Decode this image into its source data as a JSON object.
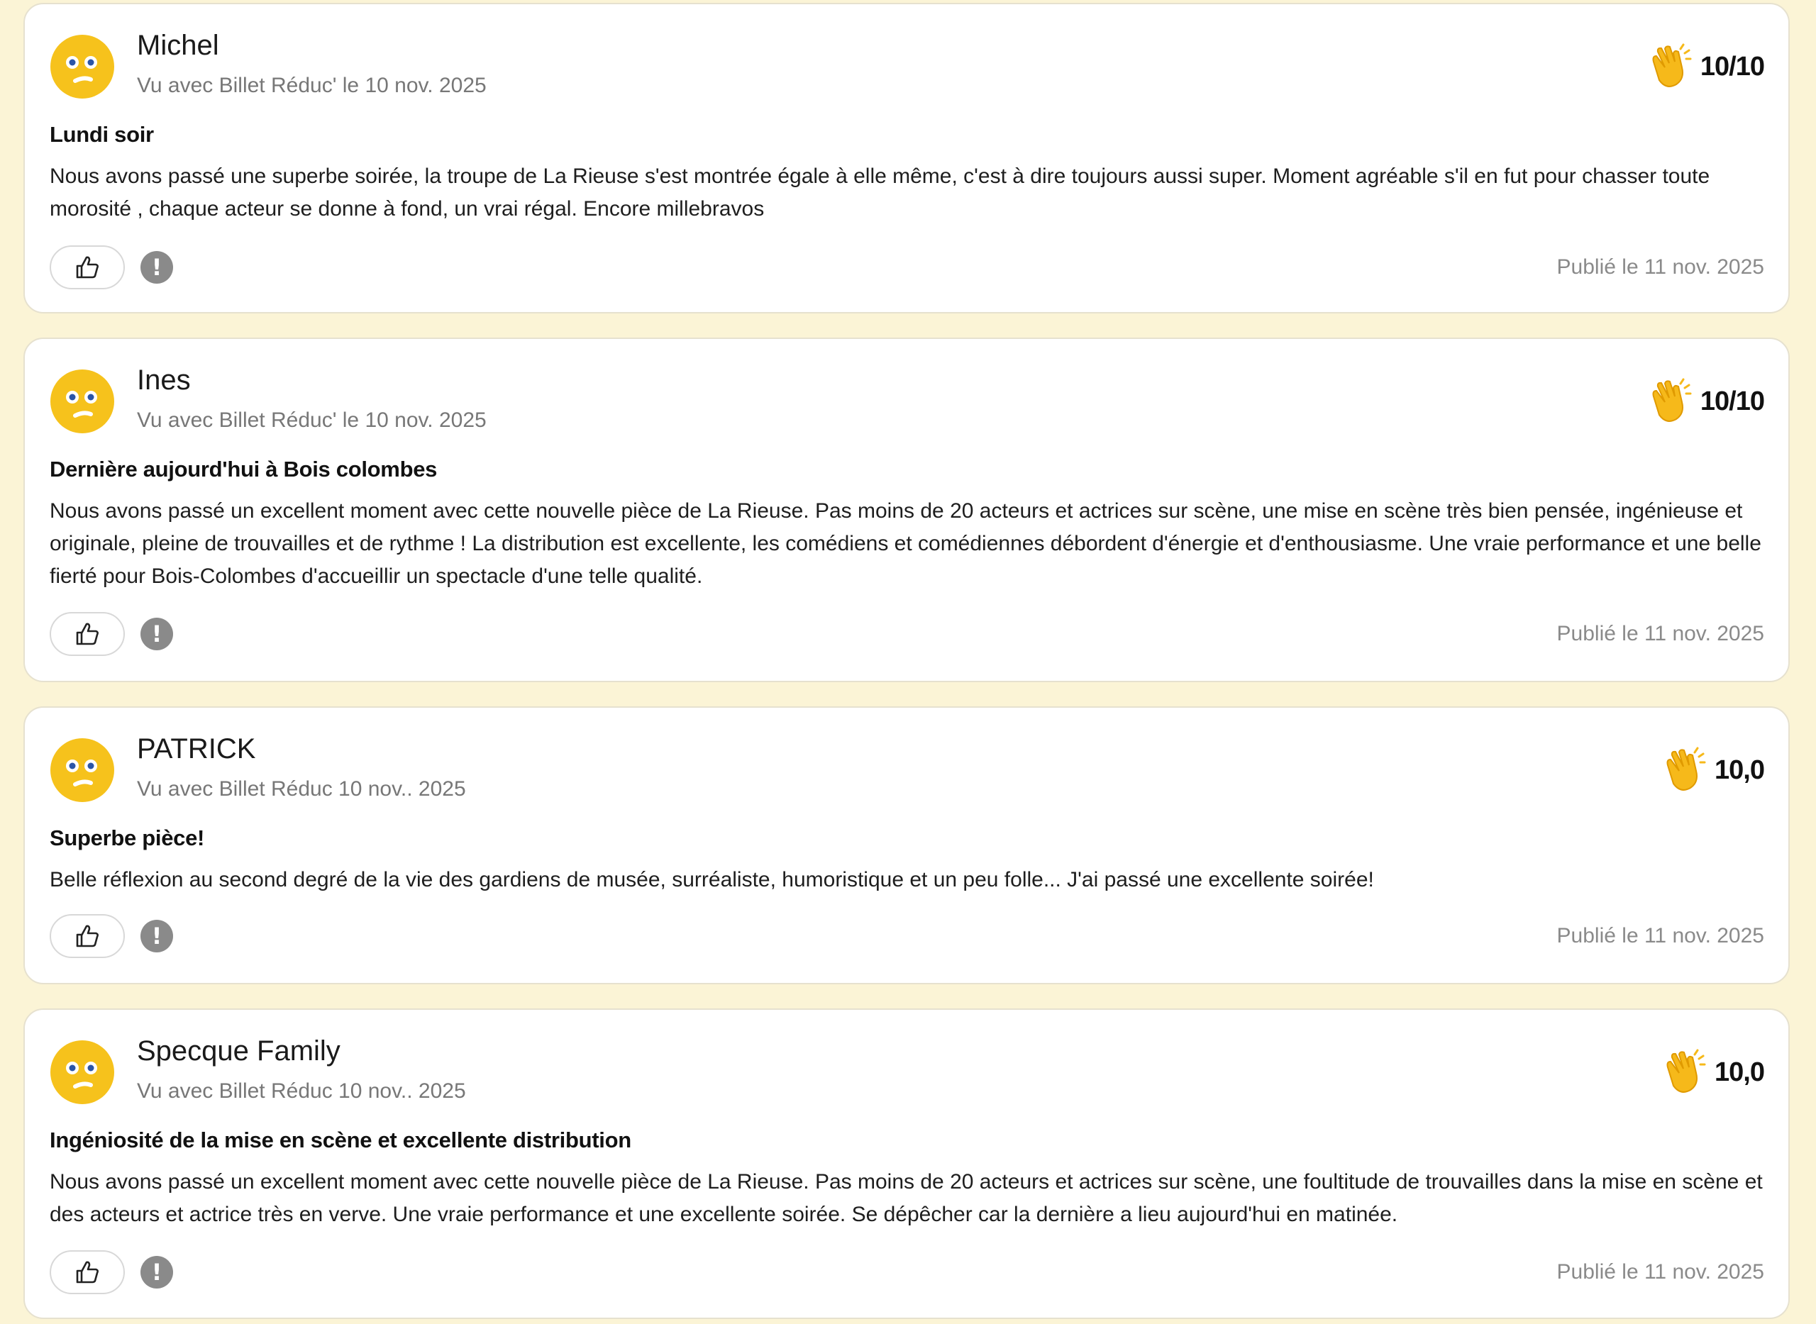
{
  "colors": {
    "page_background": "#fbf4d6",
    "card_background": "#ffffff",
    "avatar_yellow": "#f6c21c",
    "clap_yellow": "#f6b91a",
    "muted_text": "#777777"
  },
  "icons": {
    "avatar": "emoji-face-icon",
    "rating": "clapping-hands-icon",
    "like": "thumbs-up-icon",
    "report": "exclamation-icon"
  },
  "reviews": [
    {
      "author": "Michel",
      "seen_with": "Vu avec Billet Réduc' le 10 nov. 2025",
      "score": "10/10",
      "title": "Lundi soir",
      "text": "Nous avons passé une superbe soirée, la troupe de La Rieuse s'est montrée égale à elle même, c'est à dire toujours aussi super. Moment agréable s'il en fut pour chasser toute morosité , chaque acteur se donne à fond, un vrai régal. Encore millebravos",
      "published": "Publié le 11 nov. 2025"
    },
    {
      "author": "Ines",
      "seen_with": "Vu avec Billet Réduc' le 10 nov. 2025",
      "score": "10/10",
      "title": "Dernière aujourd'hui à Bois colombes",
      "text": "Nous avons passé un excellent moment avec cette nouvelle pièce de La Rieuse. Pas moins de 20 acteurs et actrices sur scène, une mise en scène très bien pensée, ingénieuse et originale, pleine de trouvailles et de rythme ! La distribution est excellente, les comédiens et comédiennes débordent d'énergie et d'enthousiasme. Une vraie performance et une belle fierté pour Bois-Colombes d'accueillir un spectacle d'une telle qualité.",
      "published": "Publié le 11 nov. 2025"
    },
    {
      "author": "PATRICK",
      "seen_with": "Vu avec Billet Réduc 10 nov.. 2025",
      "score": "10,0",
      "title": "Superbe pièce!",
      "text": "Belle réflexion au second degré de la vie des gardiens de musée, surréaliste, humoristique et un peu folle... J'ai passé une excellente soirée!",
      "published": "Publié le 11 nov. 2025"
    },
    {
      "author": "Specque Family",
      "seen_with": "Vu avec Billet Réduc 10 nov.. 2025",
      "score": "10,0",
      "title": "Ingéniosité de la mise en scène et excellente distribution",
      "text": "Nous avons passé un excellent moment avec cette nouvelle pièce de La Rieuse. Pas moins de 20 acteurs et actrices sur scène, une foultitude de trouvailles dans la mise en scène et des acteurs et actrice très en verve. Une vraie performance et une excellente soirée. Se dépêcher car la dernière a lieu aujourd'hui en matinée.",
      "published": "Publié le 11 nov. 2025"
    }
  ]
}
